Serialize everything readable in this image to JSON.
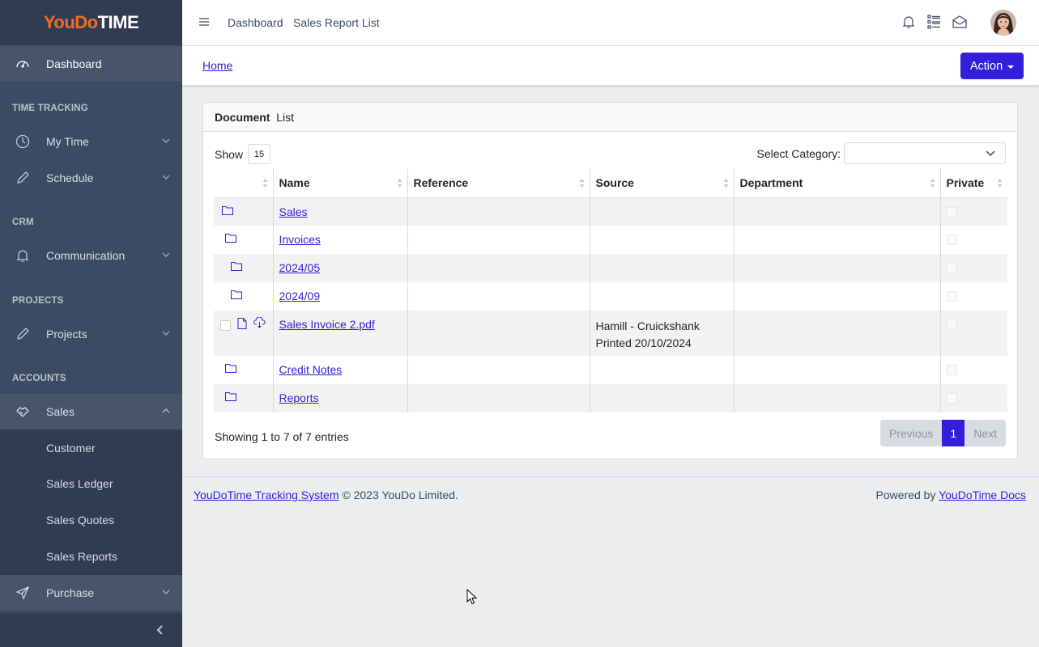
{
  "brand": {
    "part1": "YouDo",
    "part2": "TIME"
  },
  "sidebar": {
    "dashboard": "Dashboard",
    "sections": [
      "TIME TRACKING",
      "CRM",
      "PROJECTS",
      "ACCOUNTS"
    ],
    "items": {
      "my_time": "My Time",
      "schedule": "Schedule",
      "communication": "Communication",
      "projects": "Projects",
      "sales": "Sales",
      "purchase": "Purchase"
    },
    "sales_sub": [
      "Customer",
      "Sales Ledger",
      "Sales Quotes",
      "Sales Reports"
    ]
  },
  "header": {
    "nav": [
      "Dashboard",
      "Sales Report List"
    ]
  },
  "subheader": {
    "breadcrumb": "Home",
    "action": "Action"
  },
  "card": {
    "title_bold": "Document",
    "title_rest": "List",
    "show_label": "Show",
    "page_length": "15",
    "category_label": "Select Category:",
    "category_value": "",
    "columns": [
      "",
      "Name",
      "Reference",
      "Source",
      "Department",
      "Private"
    ],
    "rows": [
      {
        "name": "Sales",
        "type": "folder",
        "indent": 0,
        "source1": "",
        "source2": ""
      },
      {
        "name": "Invoices",
        "type": "folder",
        "indent": 1,
        "source1": "",
        "source2": ""
      },
      {
        "name": "2024/05",
        "type": "folder",
        "indent": 2,
        "source1": "",
        "source2": ""
      },
      {
        "name": "2024/09",
        "type": "folder",
        "indent": 2,
        "source1": "",
        "source2": ""
      },
      {
        "name": "Sales Invoice 2.pdf",
        "type": "file",
        "indent": 0,
        "source1": "Hamill - Cruickshank",
        "source2": "Printed 20/10/2024"
      },
      {
        "name": "Credit Notes",
        "type": "folder",
        "indent": 1,
        "source1": "",
        "source2": ""
      },
      {
        "name": "Reports",
        "type": "folder",
        "indent": 1,
        "source1": "",
        "source2": ""
      }
    ],
    "info": "Showing 1 to 7 of 7 entries",
    "pager": {
      "prev": "Previous",
      "current": "1",
      "next": "Next"
    }
  },
  "footer": {
    "link1": "YouDoTime Tracking System",
    "copy": " © 2023 YouDo Limited.",
    "powered": "Powered by ",
    "link2": "YouDoTime Docs"
  }
}
